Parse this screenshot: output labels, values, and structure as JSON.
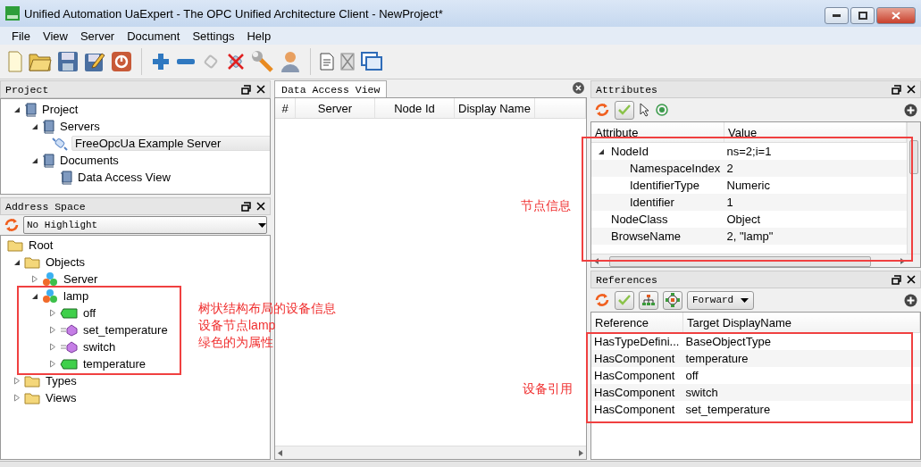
{
  "window": {
    "title": "Unified Automation UaExpert - The OPC Unified Architecture Client - NewProject*"
  },
  "menu": [
    "File",
    "View",
    "Server",
    "Document",
    "Settings",
    "Help"
  ],
  "project": {
    "title": "Project",
    "tree": [
      {
        "label": "Project",
        "kind": "book",
        "expanded": true,
        "selected": false,
        "children": [
          {
            "label": "Servers",
            "kind": "book",
            "expanded": true,
            "selected": false,
            "children": [
              {
                "label": "FreeOpcUa Example Server",
                "kind": "server",
                "selected": true
              }
            ]
          },
          {
            "label": "Documents",
            "kind": "book",
            "expanded": true,
            "selected": false,
            "children": [
              {
                "label": "Data Access View",
                "kind": "book",
                "selected": false
              }
            ]
          }
        ]
      }
    ]
  },
  "address_space": {
    "title": "Address Space",
    "highlight": "No Highlight",
    "tree": [
      {
        "label": "Root",
        "kind": "folder",
        "children": [
          {
            "label": "Objects",
            "kind": "folder",
            "expanded": true,
            "children": [
              {
                "label": "Server",
                "kind": "object",
                "expanded": false
              },
              {
                "label": "lamp",
                "kind": "object",
                "expanded": true,
                "children": [
                  {
                    "label": "off",
                    "kind": "variable",
                    "expanded": false
                  },
                  {
                    "label": "set_temperature",
                    "kind": "method",
                    "expanded": false
                  },
                  {
                    "label": "switch",
                    "kind": "method",
                    "expanded": false
                  },
                  {
                    "label": "temperature",
                    "kind": "variable",
                    "expanded": false
                  }
                ]
              }
            ]
          },
          {
            "label": "Types",
            "kind": "folder",
            "expanded": false
          },
          {
            "label": "Views",
            "kind": "folder",
            "expanded": false
          }
        ]
      }
    ]
  },
  "data_access": {
    "tab": "Data Access View",
    "columns": [
      "#",
      "Server",
      "Node Id",
      "Display Name"
    ]
  },
  "attributes": {
    "title": "Attributes",
    "columns": [
      "Attribute",
      "Value"
    ],
    "rows": [
      {
        "attribute": "NodeId",
        "value": "ns=2;i=1",
        "expanded": true,
        "children": [
          {
            "attribute": "NamespaceIndex",
            "value": "2"
          },
          {
            "attribute": "IdentifierType",
            "value": "Numeric"
          },
          {
            "attribute": "Identifier",
            "value": "1"
          }
        ]
      },
      {
        "attribute": "NodeClass",
        "value": "Object"
      },
      {
        "attribute": "BrowseName",
        "value": "2, \"lamp\""
      }
    ]
  },
  "references": {
    "title": "References",
    "direction": "Forward",
    "columns": [
      "Reference",
      "Target DisplayName"
    ],
    "rows": [
      {
        "reference": "HasTypeDefini...",
        "target": "BaseObjectType"
      },
      {
        "reference": "HasComponent",
        "target": "temperature"
      },
      {
        "reference": "HasComponent",
        "target": "off"
      },
      {
        "reference": "HasComponent",
        "target": "switch"
      },
      {
        "reference": "HasComponent",
        "target": "set_temperature"
      }
    ]
  },
  "annotations": [
    {
      "lines": [
        "树状结构布局的设备信息",
        "设备节点lamp",
        "绿色的为属性"
      ]
    },
    {
      "lines": [
        "节点信息"
      ]
    },
    {
      "lines": [
        "设备引用"
      ]
    }
  ]
}
